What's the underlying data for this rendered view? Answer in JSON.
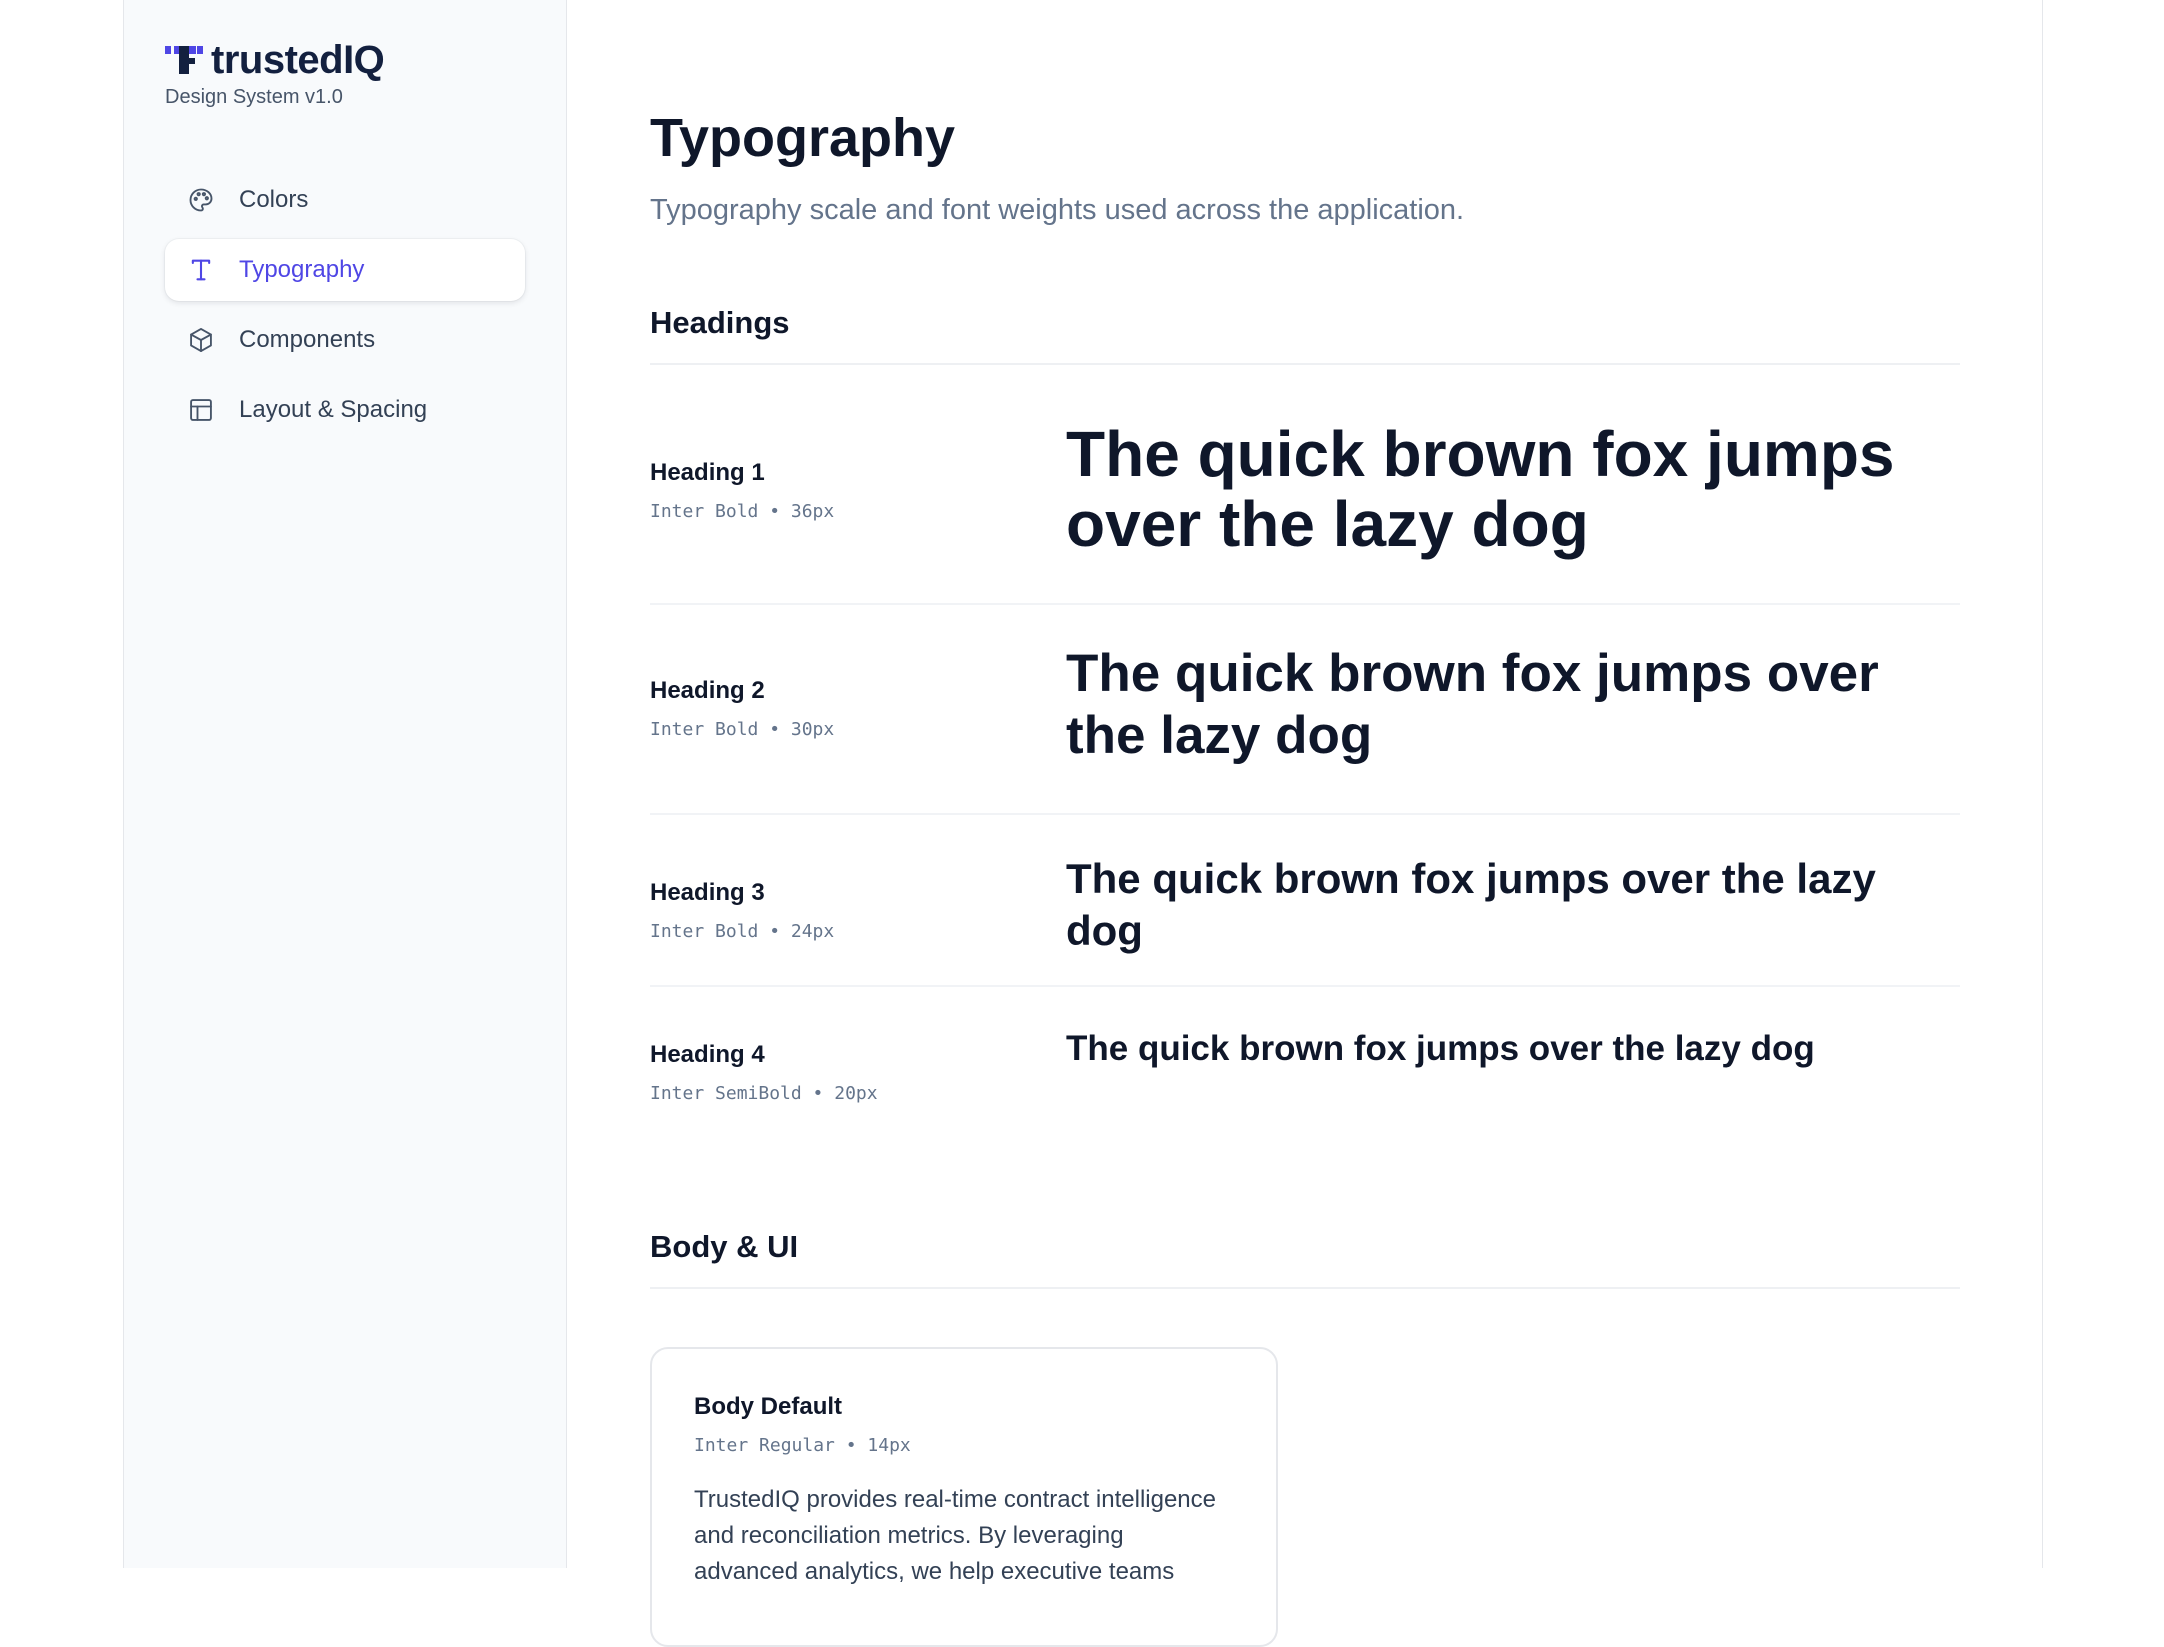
{
  "brand": {
    "name": "trustedIQ",
    "subtitle": "Design System v1.0",
    "accent": "#4f46e5",
    "logo_dark": "#13203f"
  },
  "sidebar": {
    "items": [
      {
        "label": "Colors",
        "icon": "palette-icon",
        "active": false
      },
      {
        "label": "Typography",
        "icon": "type-icon",
        "active": true
      },
      {
        "label": "Components",
        "icon": "cube-icon",
        "active": false
      },
      {
        "label": "Layout & Spacing",
        "icon": "layout-icon",
        "active": false
      }
    ]
  },
  "page": {
    "title": "Typography",
    "subtitle": "Typography scale and font weights used across the application."
  },
  "headings_section": {
    "title": "Headings",
    "rows": [
      {
        "name": "Heading 1",
        "spec": "Inter Bold • 36px",
        "sample": "The quick brown fox jumps over the lazy dog"
      },
      {
        "name": "Heading 2",
        "spec": "Inter Bold • 30px",
        "sample": "The quick brown fox jumps over the lazy dog"
      },
      {
        "name": "Heading 3",
        "spec": "Inter Bold • 24px",
        "sample": "The quick brown fox jumps over the lazy dog"
      },
      {
        "name": "Heading 4",
        "spec": "Inter SemiBold • 20px",
        "sample": "The quick brown fox jumps over the lazy dog"
      }
    ]
  },
  "body_section": {
    "title": "Body & UI",
    "cards": [
      {
        "name": "Body Default",
        "spec": "Inter Regular • 14px",
        "sample": "TrustedIQ provides real-time contract intelligence and reconciliation metrics. By leveraging advanced analytics, we help executive teams"
      }
    ]
  }
}
